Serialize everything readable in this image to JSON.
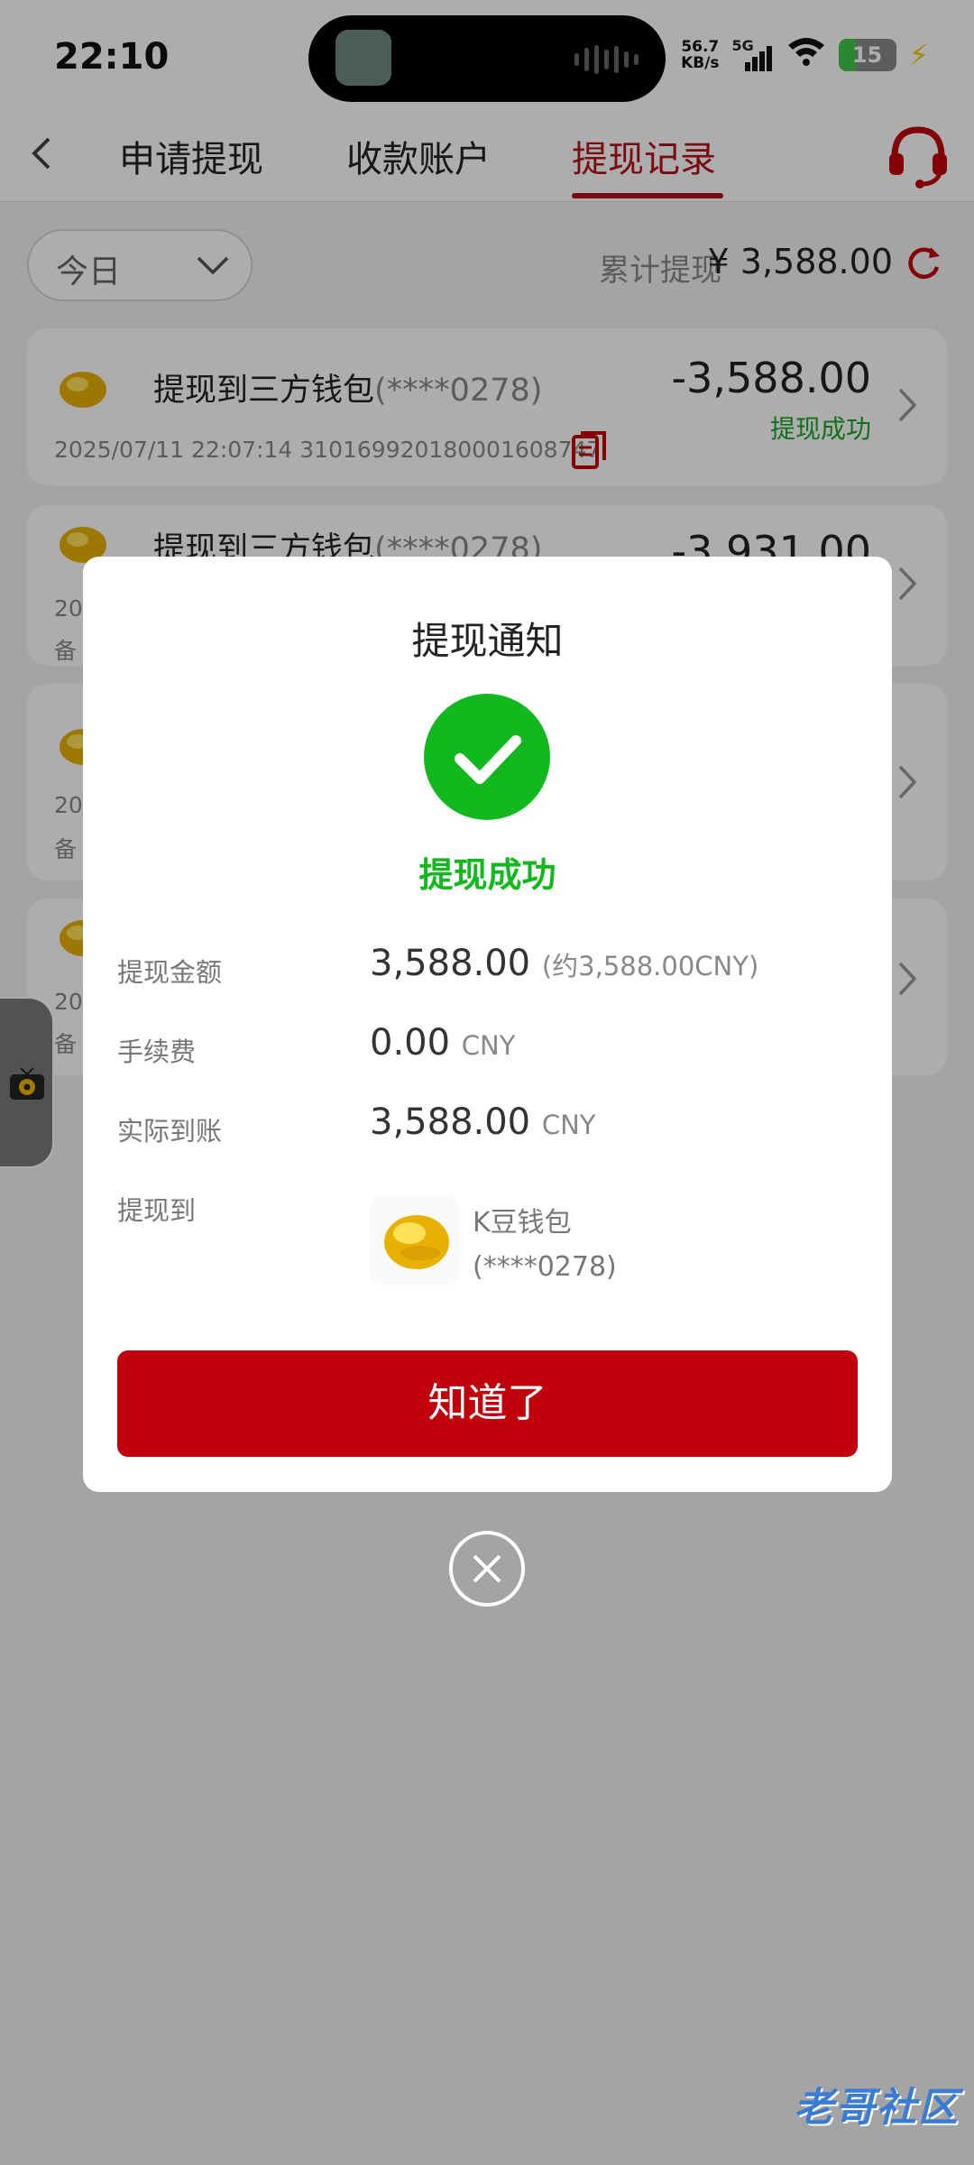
{
  "status_bar": {
    "time": "22:10",
    "net_speed_value": "56.7",
    "net_speed_unit": "KB/s",
    "network": "5G",
    "battery": "15"
  },
  "nav": {
    "tabs": [
      {
        "label": "申请提现",
        "active": false
      },
      {
        "label": "收款账户",
        "active": false
      },
      {
        "label": "提现记录",
        "active": true
      }
    ]
  },
  "filter": {
    "period": "今日",
    "total_label": "累计提现",
    "total_value": "¥ 3,588.00"
  },
  "records": [
    {
      "title": "提现到三方钱包",
      "account": "(****0278)",
      "amount": "-3,588.00",
      "status": "提现成功",
      "datetime": "2025/07/11 22:07:14",
      "order_no": "3101699201800016087​47"
    },
    {
      "title": "提现到三方钱包",
      "account": "(****0278)",
      "amount": "-3,931.00",
      "meta_prefix": "20",
      "note_prefix": "备"
    },
    {
      "meta_prefix": "20",
      "note_prefix": "备"
    },
    {
      "meta_prefix": "20",
      "note_prefix": "备"
    }
  ],
  "modal": {
    "title": "提现通知",
    "status": "提现成功",
    "rows": {
      "amount_label": "提现金额",
      "amount_value": "3,588.00",
      "amount_note": "(约3,588.00CNY)",
      "fee_label": "手续费",
      "fee_value": "0.00",
      "fee_unit": "CNY",
      "received_label": "实际到账",
      "received_value": "3,588.00",
      "received_unit": "CNY",
      "to_label": "提现到"
    },
    "wallet_name": "K豆钱包",
    "wallet_account": "(****0278)",
    "confirm_label": "知道了"
  },
  "watermark": "老哥社区",
  "colors": {
    "brand_red": "#b3121c",
    "button_red": "#c0000a",
    "success_green": "#13b81f"
  }
}
